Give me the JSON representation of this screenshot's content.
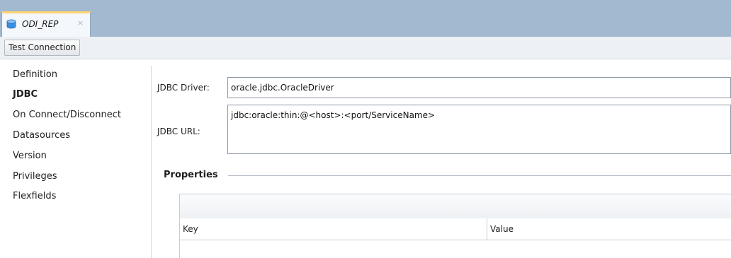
{
  "editor_tab": {
    "title": "ODI_REP",
    "close_glyph": "×",
    "icon": "database-icon",
    "icon_color": "#3b8fe0"
  },
  "toolbar": {
    "test_connection_label": "Test Connection"
  },
  "sidebar": {
    "items": [
      {
        "label": "Definition",
        "active": false
      },
      {
        "label": "JDBC",
        "active": true
      },
      {
        "label": "On Connect/Disconnect",
        "active": false
      },
      {
        "label": "Datasources",
        "active": false
      },
      {
        "label": "Version",
        "active": false
      },
      {
        "label": "Privileges",
        "active": false
      },
      {
        "label": "Flexfields",
        "active": false
      }
    ]
  },
  "jdbc": {
    "driver_label": "JDBC Driver:",
    "driver_value": "oracle.jdbc.OracleDriver",
    "url_label": "JDBC URL:",
    "url_value": "jdbc:oracle:thin:@<host>:<port/ServiceName>"
  },
  "properties": {
    "title": "Properties",
    "columns": [
      "Key",
      "Value"
    ]
  }
}
